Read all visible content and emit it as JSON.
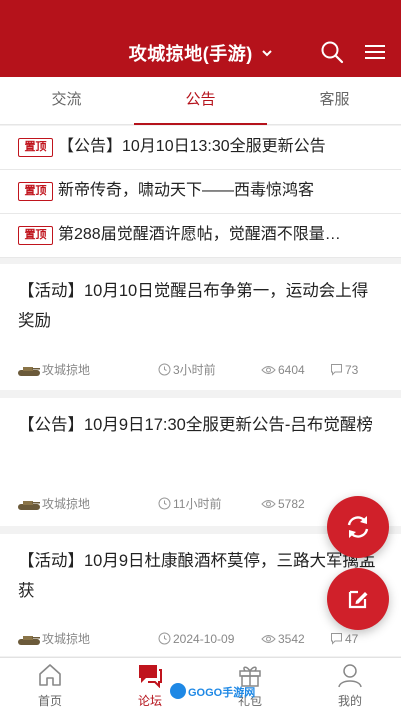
{
  "header": {
    "title": "攻城掠地(手游)"
  },
  "tabs": [
    {
      "label": "交流"
    },
    {
      "label": "公告"
    },
    {
      "label": "客服"
    }
  ],
  "pinned": {
    "badge": "置顶",
    "items": [
      {
        "text": "【公告】10月10日13:30全服更新公告"
      },
      {
        "text": "新帝传奇，啸动天下——西毒惊鸿客"
      },
      {
        "text": "第288届觉醒酒许愿帖，觉醒酒不限量…"
      }
    ]
  },
  "posts": [
    {
      "title": "【活动】10月10日觉醒吕布争第一，运动会上得奖励",
      "forum": "攻城掠地",
      "time": "3小时前",
      "views": "6404",
      "comments": "73"
    },
    {
      "title": "【公告】10月9日17:30全服更新公告-吕布觉醒榜",
      "forum": "攻城掠地",
      "time": "11小时前",
      "views": "5782",
      "comments": ""
    },
    {
      "title": "【活动】10月9日杜康酿酒杯莫停，三路大军擒孟获",
      "forum": "攻城掠地",
      "time": "2024-10-09",
      "views": "3542",
      "comments": "47"
    }
  ],
  "bottom_nav": [
    {
      "label": "首页",
      "icon": "home-icon"
    },
    {
      "label": "论坛",
      "icon": "forum-icon"
    },
    {
      "label": "礼包",
      "icon": "gift-icon"
    },
    {
      "label": "我的",
      "icon": "user-icon"
    }
  ],
  "watermark": {
    "text": "GOGO手游网"
  },
  "colors": {
    "brand": "#b5121b",
    "fab": "#d0202a"
  }
}
